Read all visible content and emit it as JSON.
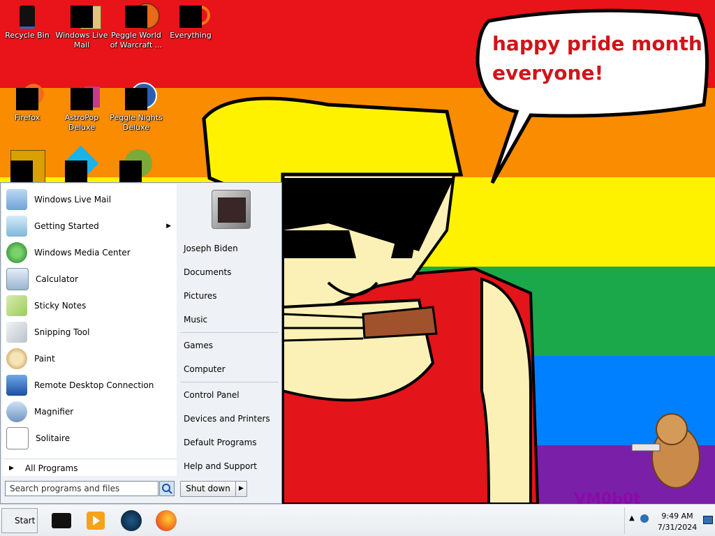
{
  "desktop": {
    "speech_text_line1": "happy pride month",
    "speech_text_line2": "everyone!",
    "watermark": "VM0b0t",
    "icons": [
      {
        "label": "Recycle Bin"
      },
      {
        "label": "Windows Live Mail"
      },
      {
        "label": "Peggle World of Warcraft ..."
      },
      {
        "label": "Everything"
      },
      {
        "label": "Firefox"
      },
      {
        "label": "AstroPop Deluxe"
      },
      {
        "label": "Peggle Nights Deluxe"
      }
    ]
  },
  "start_menu": {
    "programs": [
      {
        "label": "Windows Live Mail",
        "icon": "mail-icon"
      },
      {
        "label": "Getting Started",
        "icon": "getting-started-icon",
        "submenu": true
      },
      {
        "label": "Windows Media Center",
        "icon": "media-center-icon"
      },
      {
        "label": "Calculator",
        "icon": "calculator-icon"
      },
      {
        "label": "Sticky Notes",
        "icon": "sticky-notes-icon"
      },
      {
        "label": "Snipping Tool",
        "icon": "snipping-tool-icon"
      },
      {
        "label": "Paint",
        "icon": "paint-icon"
      },
      {
        "label": "Remote Desktop Connection",
        "icon": "remote-desktop-icon"
      },
      {
        "label": "Magnifier",
        "icon": "magnifier-icon"
      },
      {
        "label": "Solitaire",
        "icon": "solitaire-icon"
      }
    ],
    "all_programs": "All Programs",
    "search_placeholder": "Search programs and files",
    "right_items": {
      "user": "Joseph Biden",
      "documents": "Documents",
      "pictures": "Pictures",
      "music": "Music",
      "games": "Games",
      "computer": "Computer",
      "control_panel": "Control Panel",
      "devices": "Devices and Printers",
      "default_programs": "Default Programs",
      "help": "Help and Support"
    },
    "shutdown_label": "Shut down"
  },
  "taskbar": {
    "start_label": "Start",
    "apps": [
      "terminal-icon",
      "media-player-icon",
      "globe-icon",
      "firefox-icon"
    ],
    "tray": {
      "time": "9:49 AM",
      "date": "7/31/2024"
    }
  },
  "colors": {
    "red": "#e8141a",
    "orange": "#f98c00",
    "yellow": "#fff200",
    "green": "#1aa84b",
    "blue": "#0080ff",
    "purple": "#7a20a8",
    "speech_text": "#d0141a"
  }
}
